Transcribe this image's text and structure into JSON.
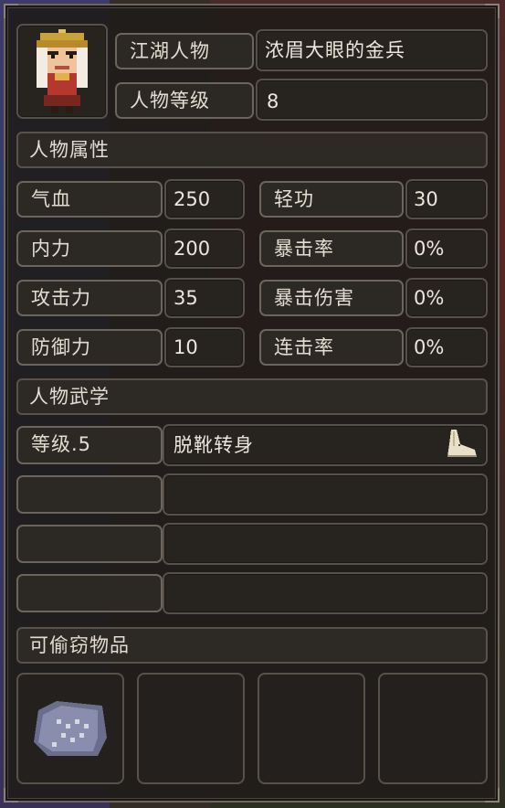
{
  "character": {
    "label_name": "江湖人物",
    "name": "浓眉大眼的金兵",
    "label_level": "人物等级",
    "level": "8"
  },
  "attributes": {
    "title": "人物属性",
    "left": [
      {
        "label": "气血",
        "value": "250"
      },
      {
        "label": "内力",
        "value": "200"
      },
      {
        "label": "攻击力",
        "value": "35"
      },
      {
        "label": "防御力",
        "value": "10"
      }
    ],
    "right": [
      {
        "label": "轻功",
        "value": "30"
      },
      {
        "label": "暴击率",
        "value": "0%"
      },
      {
        "label": "暴击伤害",
        "value": "0%"
      },
      {
        "label": "连击率",
        "value": "0%"
      }
    ]
  },
  "martial": {
    "title": "人物武学",
    "skills": [
      {
        "level": "等级.5",
        "name": "脱靴转身",
        "icon": "boot-icon"
      }
    ]
  },
  "items": {
    "title": "可偷窃物品",
    "slots": [
      {
        "icon": "scroll-icon"
      }
    ]
  }
}
